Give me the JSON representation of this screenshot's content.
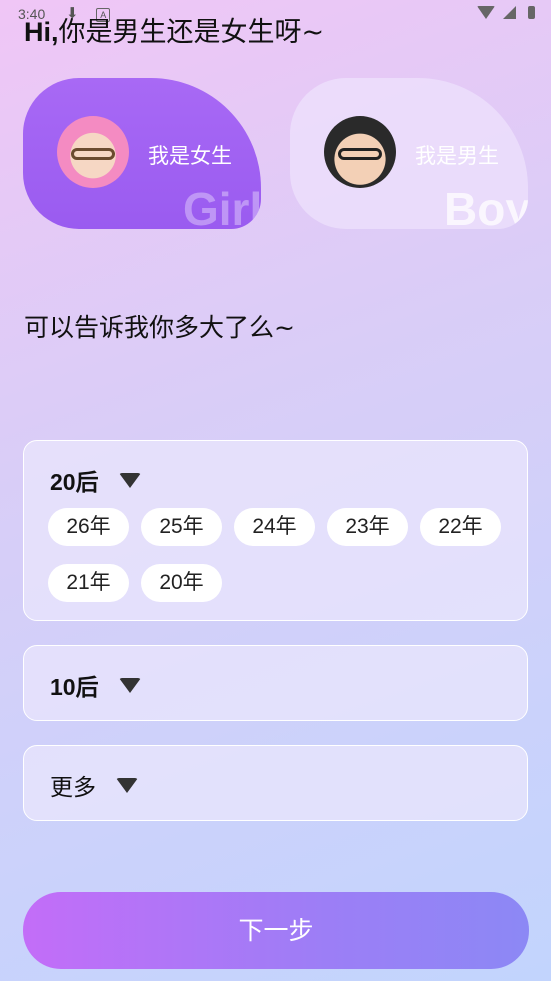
{
  "status_bar": {
    "time": "3:40",
    "a_badge": "A"
  },
  "greeting": {
    "hi": "Hi,",
    "question": "你是男生还是女生呀~"
  },
  "gender": {
    "girl": {
      "label": "我是女生",
      "watermark": "Girl"
    },
    "boy": {
      "label": "我是男生",
      "watermark": "Boy"
    }
  },
  "age_question": "可以告诉我你多大了么~",
  "age_groups": {
    "group_20": {
      "label": "20后",
      "chips": [
        "26年",
        "25年",
        "24年",
        "23年",
        "22年",
        "21年",
        "20年"
      ]
    },
    "group_10": {
      "label": "10后"
    },
    "group_more": {
      "label": "更多"
    }
  },
  "next_button": {
    "label": "下一步"
  },
  "colors": {
    "selected_card": "#a166f3",
    "button_start": "#c36df8",
    "button_end": "#8c88f5"
  }
}
